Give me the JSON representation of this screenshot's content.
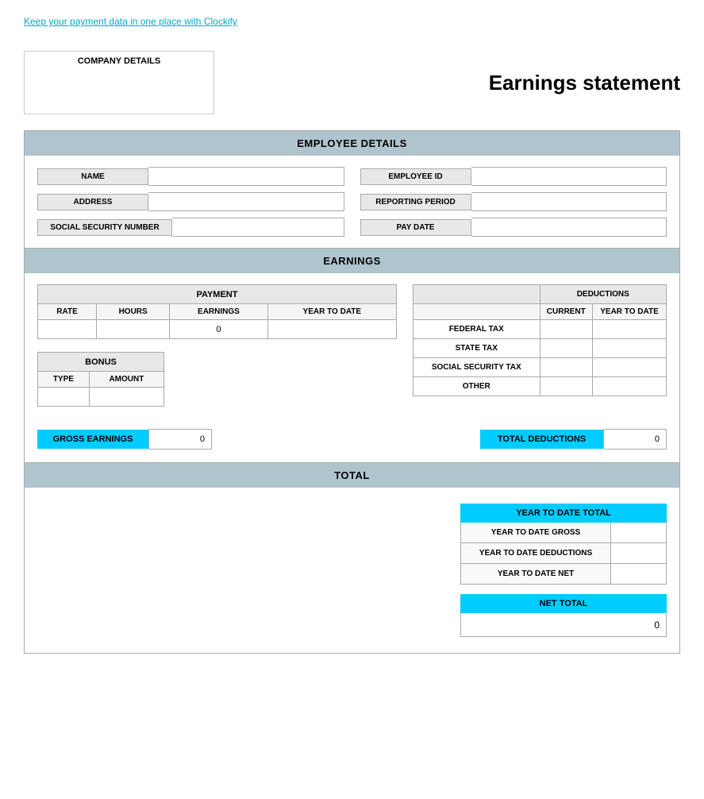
{
  "topLink": {
    "text": "Keep your payment data in one place with Clockify"
  },
  "companyDetails": {
    "label": "COMPANY DETAILS"
  },
  "header": {
    "title": "Earnings statement"
  },
  "employeeDetails": {
    "sectionLabel": "EMPLOYEE DETAILS",
    "fields": {
      "name": {
        "label": "NAME",
        "value": ""
      },
      "employeeId": {
        "label": "EMPLOYEE ID",
        "value": ""
      },
      "address": {
        "label": "ADDRESS",
        "value": ""
      },
      "reportingPeriod": {
        "label": "REPORTING PERIOD",
        "value": ""
      },
      "socialSecurityNumber": {
        "label": "SOCIAL SECURITY NUMBER",
        "value": ""
      },
      "payDate": {
        "label": "PAY DATE",
        "value": ""
      }
    }
  },
  "earnings": {
    "sectionLabel": "EARNINGS",
    "payment": {
      "tableHeader": "PAYMENT",
      "columns": [
        "RATE",
        "HOURS",
        "EARNINGS",
        "YEAR TO DATE"
      ],
      "rows": [
        {
          "rate": "",
          "hours": "",
          "earnings": "0",
          "yearToDate": ""
        }
      ]
    },
    "deductions": {
      "tableHeader": "DEDUCTIONS",
      "columns": [
        "",
        "CURRENT",
        "YEAR TO DATE"
      ],
      "rows": [
        {
          "label": "FEDERAL TAX",
          "current": "",
          "yearToDate": ""
        },
        {
          "label": "STATE TAX",
          "current": "",
          "yearToDate": ""
        },
        {
          "label": "SOCIAL SECURITY TAX",
          "current": "",
          "yearToDate": ""
        },
        {
          "label": "OTHER",
          "current": "",
          "yearToDate": ""
        }
      ]
    },
    "bonus": {
      "tableHeader": "BONUS",
      "columns": [
        "TYPE",
        "AMOUNT"
      ],
      "rows": [
        {
          "type": "",
          "amount": ""
        }
      ]
    }
  },
  "totalsBar": {
    "grossEarningsLabel": "GROSS EARNINGS",
    "grossEarningsValue": "0",
    "totalDeductionsLabel": "TOTAL DEDUCTIONS",
    "totalDeductionsValue": "0"
  },
  "total": {
    "sectionLabel": "TOTAL",
    "ytdTotal": {
      "header": "YEAR TO DATE TOTAL",
      "rows": [
        {
          "label": "YEAR TO DATE GROSS",
          "value": ""
        },
        {
          "label": "YEAR TO DATE DEDUCTIONS",
          "value": ""
        },
        {
          "label": "YEAR TO DATE NET",
          "value": ""
        }
      ]
    },
    "netTotal": {
      "header": "NET TOTAL",
      "value": "0"
    }
  }
}
